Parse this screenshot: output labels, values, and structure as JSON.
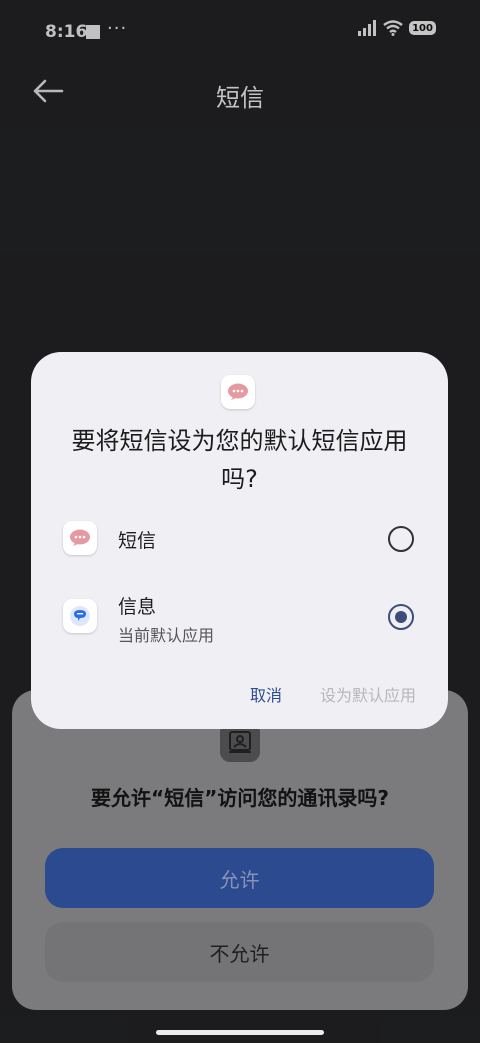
{
  "status_bar": {
    "time": "8:16",
    "more": "···",
    "battery": "100",
    "icons": [
      "signal-icon",
      "wifi-icon",
      "battery-icon"
    ]
  },
  "app_bar": {
    "title": "短信",
    "icon": "back-arrow-icon"
  },
  "dialog": {
    "app_icon": "sms-bubble-icon",
    "title": "要将短信设为您的默认短信应用吗?",
    "options": [
      {
        "label": "短信",
        "subtitle": "",
        "selected": false,
        "icon": "sms-bubble-icon"
      },
      {
        "label": "信息",
        "subtitle": "当前默认应用",
        "selected": true,
        "icon": "messages-icon"
      }
    ],
    "cancel_label": "取消",
    "set_default_label": "设为默认应用"
  },
  "permission_sheet": {
    "icon": "contacts-icon",
    "title": "要允许“短信”访问您的通讯录吗?",
    "allow_label": "允许",
    "deny_label": "不允许"
  },
  "colors": {
    "background": "#232426",
    "dialog_background": "#f0eff4",
    "accent": "#2f4e8f",
    "disabled_text": "#b8b8bb",
    "allow_button": "#2c4a8f"
  }
}
